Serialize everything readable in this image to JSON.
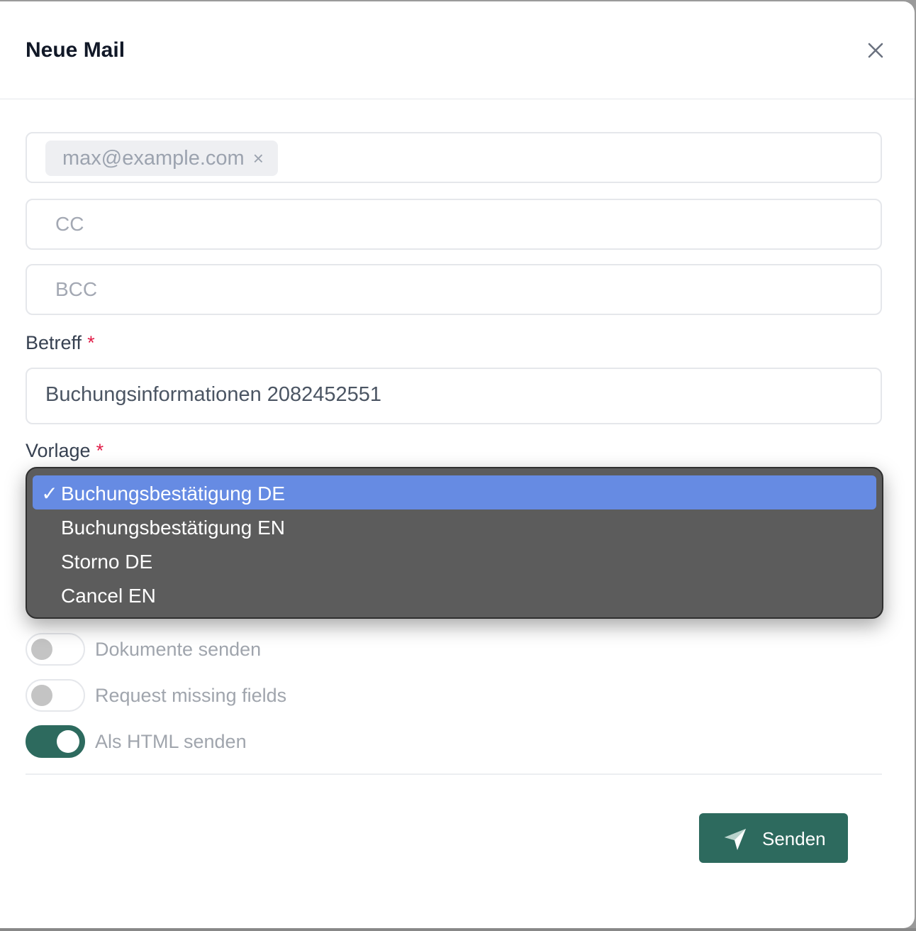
{
  "modal": {
    "title": "Neue Mail"
  },
  "recipients": {
    "to_chip": "max@example.com",
    "chip_remove_glyph": "×",
    "cc_placeholder": "CC",
    "bcc_placeholder": "BCC"
  },
  "subject": {
    "label": "Betreff",
    "required_marker": "*",
    "value": "Buchungsinformationen 2082452551"
  },
  "template": {
    "label": "Vorlage",
    "required_marker": "*",
    "check_glyph": "✓",
    "options": [
      "Buchungsbestätigung DE",
      "Buchungsbestätigung EN",
      "Storno DE",
      "Cancel EN"
    ],
    "selected_index": 0
  },
  "toggles": [
    {
      "label": "Dokumente senden",
      "on": false
    },
    {
      "label": "Request missing fields",
      "on": false
    },
    {
      "label": "Als HTML senden",
      "on": true
    }
  ],
  "footer": {
    "send_label": "Senden"
  },
  "colors": {
    "accent": "#2d6a5e",
    "selected_option": "#668be3",
    "required": "#e11d48",
    "dropdown_bg": "#5c5c5c"
  },
  "icons": {
    "close": "close-icon",
    "send": "paper-plane-icon",
    "check": "checkmark-icon"
  }
}
